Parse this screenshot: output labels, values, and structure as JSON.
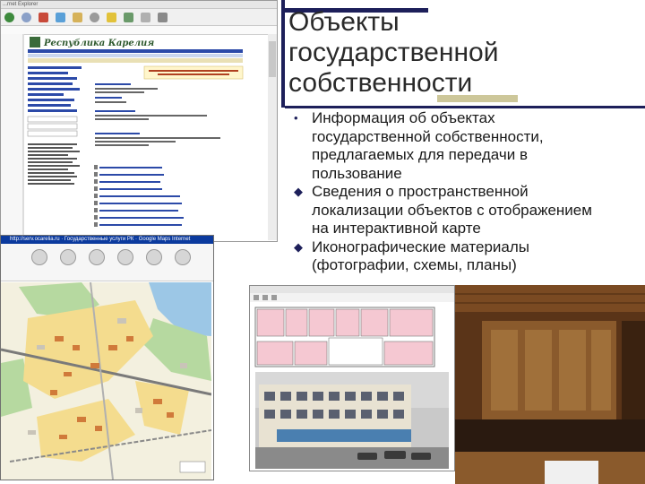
{
  "slide": {
    "title_lines": [
      "Объекты",
      "государственной",
      "собственности"
    ],
    "bullets": [
      {
        "lines": [
          "Информация об объектах",
          "государственной собственности,",
          "предлагаемых для передачи в",
          "пользование"
        ]
      },
      {
        "lines": [
          "Сведения о пространственной",
          "локализации объектов с отображением",
          "на интерактивной карте"
        ]
      },
      {
        "lines": [
          "Иконографические материалы",
          "(фотографии, схемы, планы)"
        ]
      }
    ]
  },
  "colors": {
    "accent_navy": "#1d1f5a",
    "accent_olive": "#cdc79a",
    "map_title_bar": "#0b3a9e"
  },
  "browser_screenshot": {
    "window_title": "...rnet Explorer",
    "logo_text": "Республика Карелия"
  },
  "map_screenshot": {
    "window_title": "http://serv.ocarelia.ru · Государственные услуги РК · Google Maps Internet"
  }
}
